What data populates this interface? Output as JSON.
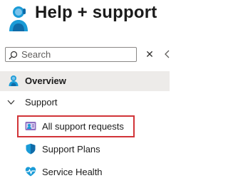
{
  "header": {
    "title": "Help + support",
    "icon": "help-support-person-icon"
  },
  "search": {
    "placeholder": "Search",
    "value": ""
  },
  "nav": {
    "overview": {
      "label": "Overview",
      "icon": "person-help-icon"
    },
    "support_group": {
      "label": "Support",
      "expanded": true
    },
    "items": [
      {
        "label": "All support requests",
        "icon": "support-requests-icon",
        "highlighted": true
      },
      {
        "label": "Support Plans",
        "icon": "shield-icon"
      },
      {
        "label": "Service Health",
        "icon": "heart-pulse-icon"
      }
    ]
  },
  "colors": {
    "accent": "#0078d4",
    "highlight_border": "#d13438",
    "selected_bg": "#edebe9"
  }
}
